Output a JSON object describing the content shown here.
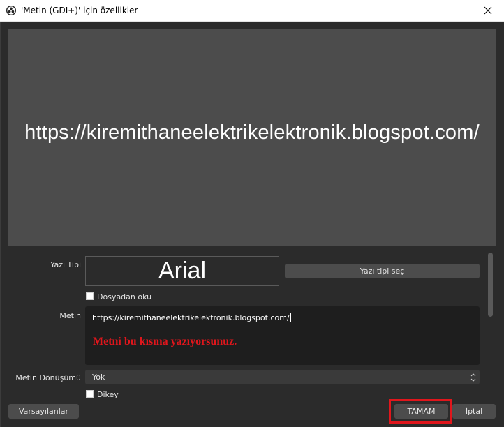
{
  "window": {
    "title": "'Metin (GDI+)' için özellikler",
    "close_glyph": "✕",
    "app_icon": "obs-icon"
  },
  "preview": {
    "text": "https://kiremithaneelektrikelektronik.blogspot.com/"
  },
  "properties": {
    "font_label": "Yazı Tipi",
    "font_name": "Arial",
    "font_select_button": "Yazı tipi seç",
    "read_from_file_label": "Dosyadan oku",
    "text_label": "Metin",
    "text_value": "https://kiremithaneelektrikelektronik.blogspot.com/",
    "annotation": "Metni bu kısma yazıyorsunuz.",
    "transform_label": "Metin Dönüşümü",
    "transform_value": "Yok",
    "vertical_label": "Dikey"
  },
  "footer": {
    "defaults_button": "Varsayılanlar",
    "ok_button": "TAMAM",
    "cancel_button": "İptal"
  },
  "colors": {
    "background": "#2b2b2b",
    "preview": "#4c4c4c",
    "highlight": "#e0161c"
  }
}
